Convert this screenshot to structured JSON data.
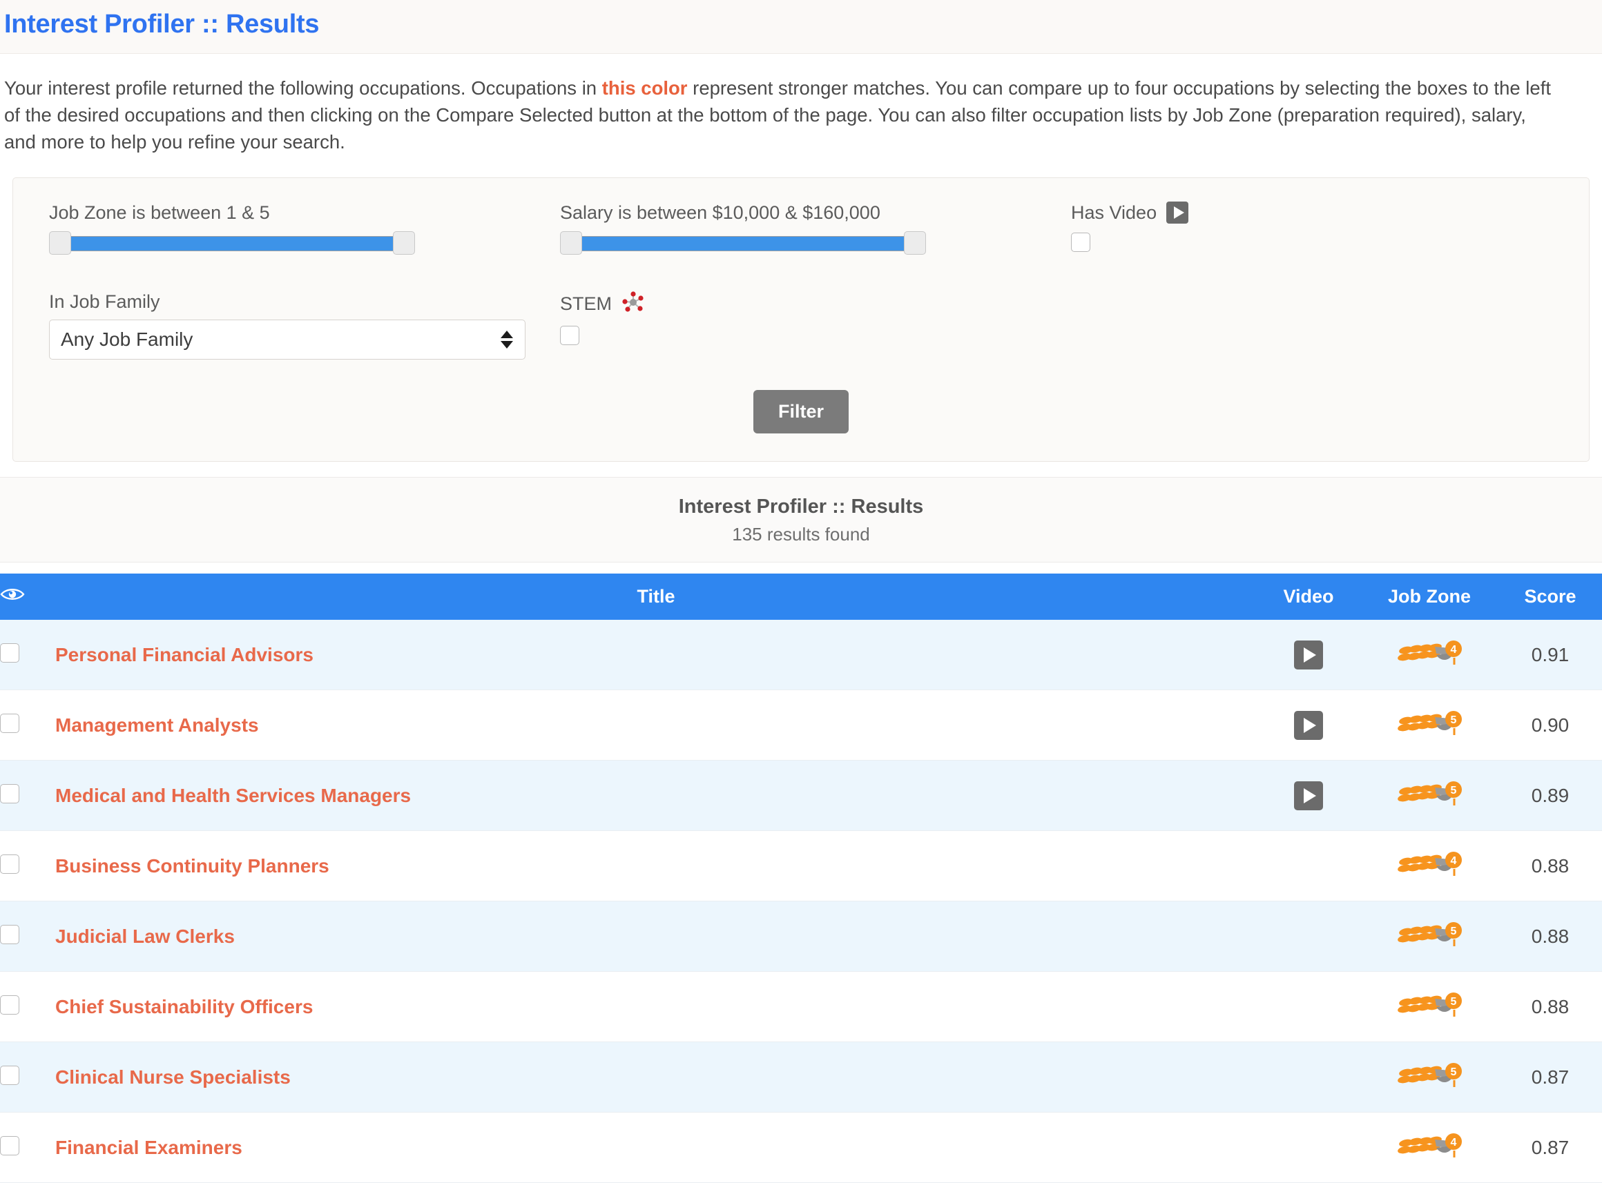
{
  "page": {
    "title": "Interest Profiler :: Results"
  },
  "intro": {
    "part1": "Your interest profile returned the following occupations. Occupations in ",
    "accent": "this color",
    "part2": " represent stronger matches. You can compare up to four occupations by selecting the boxes to the left of the desired occupations and then clicking on the Compare Selected button at the bottom of the page. You can also filter occupation lists by Job Zone (preparation required), salary, and more to help you refine your search."
  },
  "filters": {
    "job_zone_label": "Job Zone is between 1 & 5",
    "job_zone_min": "1",
    "job_zone_max": "5",
    "salary_label": "Salary is between $10,000 & $160,000",
    "salary_min": "$10,000",
    "salary_max": "$160,000",
    "job_family_label": "In Job Family",
    "job_family_value": "Any Job Family",
    "stem_label": "STEM",
    "stem_checked": false,
    "has_video_label": "Has Video",
    "has_video_checked": false,
    "filter_button": "Filter"
  },
  "results": {
    "title": "Interest Profiler :: Results",
    "count_text": "135 results found",
    "columns": {
      "check": "",
      "title": "Title",
      "video": "Video",
      "job_zone": "Job Zone",
      "score": "Score"
    },
    "rows": [
      {
        "title": "Personal Financial Advisors",
        "has_video": true,
        "job_zone": "4",
        "score": "0.91",
        "checked": false
      },
      {
        "title": "Management Analysts",
        "has_video": true,
        "job_zone": "5",
        "score": "0.90",
        "checked": false
      },
      {
        "title": "Medical and Health Services Managers",
        "has_video": true,
        "job_zone": "5",
        "score": "0.89",
        "checked": false
      },
      {
        "title": "Business Continuity Planners",
        "has_video": false,
        "job_zone": "4",
        "score": "0.88",
        "checked": false
      },
      {
        "title": "Judicial Law Clerks",
        "has_video": false,
        "job_zone": "5",
        "score": "0.88",
        "checked": false
      },
      {
        "title": "Chief Sustainability Officers",
        "has_video": false,
        "job_zone": "5",
        "score": "0.88",
        "checked": false
      },
      {
        "title": "Clinical Nurse Specialists",
        "has_video": false,
        "job_zone": "5",
        "score": "0.87",
        "checked": false
      },
      {
        "title": "Financial Examiners",
        "has_video": false,
        "job_zone": "4",
        "score": "0.87",
        "checked": false
      }
    ]
  },
  "colors": {
    "title_blue": "#2f73f0",
    "accent_orange": "#e8613c",
    "link_orange": "#e8694a",
    "header_blue": "#2f86f0",
    "row_alt": "#ecf6fd",
    "slider_fill": "#3d93e8",
    "button_gray": "#7b7b7b",
    "badge_orange": "#f5931e"
  },
  "icons": {
    "eye": "eye-icon",
    "play": "play-icon",
    "stem": "stem-molecule-icon",
    "job_zone": "wheat-badge-icon"
  }
}
